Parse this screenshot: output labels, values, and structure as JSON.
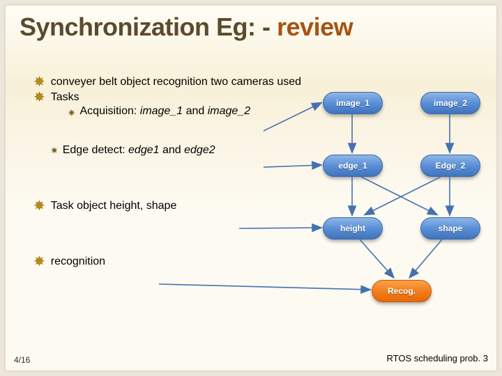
{
  "title_plain": "Synchronization Eg: - ",
  "title_accent": "review",
  "bullets": {
    "b1": " conveyer belt object recognition two cameras used",
    "b2": "Tasks",
    "b2a_prefix": "Acquisition: ",
    "b2a_it1": "image_1",
    "b2a_mid": " and ",
    "b2a_it2": "image_2",
    "b3_prefix": "Edge detect: ",
    "b3_it1": "edge1",
    "b3_mid": " and ",
    "b3_it2": "edge2",
    "b4_prefix": "Task",
    "b4_rest": " object height, shape",
    "b5": " recognition"
  },
  "nodes": {
    "image1": "image_1",
    "image2": "image_2",
    "edge1": "edge_1",
    "edge2": "Edge_2",
    "height": "height",
    "shape": "shape",
    "recog": "Recog."
  },
  "footer": {
    "left": "4/16",
    "right": "RTOS scheduling prob. 3"
  }
}
